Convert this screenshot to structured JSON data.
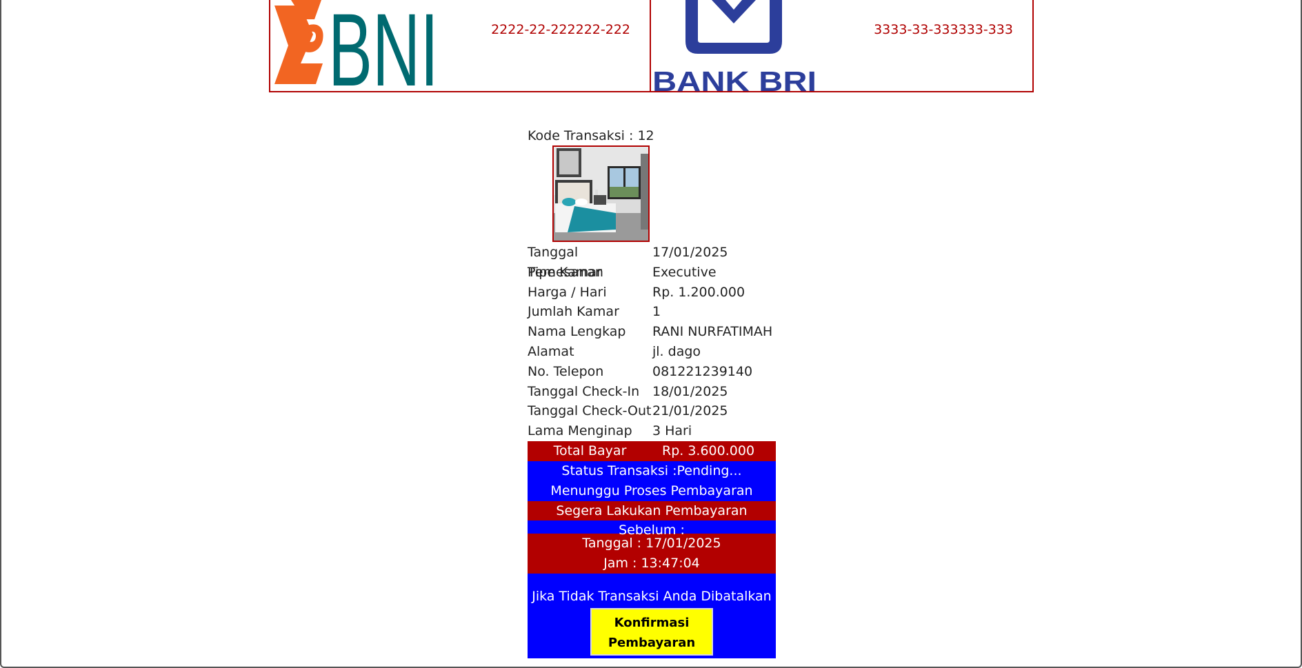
{
  "banks": [
    {
      "logo_icon": "bni-logo",
      "logo_text": "BNI",
      "account": "2222-22-222222-222",
      "accent": "#b00000"
    },
    {
      "logo_icon": "bri-logo",
      "logo_text": "BANK BRI",
      "account": "3333-33-333333-333",
      "accent": "#b00000"
    }
  ],
  "transaction": {
    "code_label": "Kode Transaksi : 12",
    "photo_icon": "hotel-room-photo",
    "details": [
      {
        "label": "Tanggal Pemesanan",
        "value": "17/01/2025"
      },
      {
        "label": "Tipe Kamar",
        "value": "Executive"
      },
      {
        "label": "Harga / Hari",
        "value": "Rp. 1.200.000"
      },
      {
        "label": "Jumlah Kamar",
        "value": "1"
      },
      {
        "label": "Nama Lengkap",
        "value": "RANI NURFATIMAH"
      },
      {
        "label": "Alamat",
        "value": "jl. dago"
      },
      {
        "label": "No. Telepon",
        "value": "081221239140"
      },
      {
        "label": "Tanggal Check-In",
        "value": "18/01/2025"
      },
      {
        "label": "Tanggal Check-Out",
        "value": "21/01/2025"
      },
      {
        "label": "Lama Menginap",
        "value": "3 Hari"
      }
    ],
    "total": {
      "label": "Total Bayar",
      "value": "Rp. 3.600.000"
    },
    "status_line": "Status Transaksi :Pending...",
    "waiting_line": "Menunggu Proses Pembayaran",
    "deadline_heading": "Segera Lakukan Pembayaran Sebelum :",
    "deadline_date": "Tanggal : 17/01/2025",
    "deadline_time": "Jam : 13:47:04",
    "cancel_notice": "Jika Tidak Transaksi Anda Dibatalkan",
    "confirm_button": "Konfirmasi Pembayaran"
  },
  "colors": {
    "red": "#b20000",
    "blue": "#0000ff",
    "button": "#ffff00"
  }
}
